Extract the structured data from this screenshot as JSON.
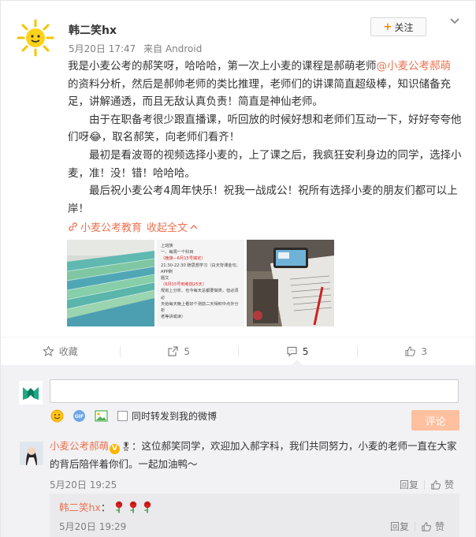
{
  "post": {
    "username": "韩二笑hx",
    "date": "5月20日 17:47",
    "source": "来自 Android",
    "follow_label": "关注",
    "paragraphs": [
      {
        "before": "我是小麦公考的郝笑呀，哈哈哈，第一次上小麦的课程是郝萌老师",
        "mention": "@小麦公考郝萌",
        "after": " 的资料分析，然后是郝帅老师的类比推理，老师们的讲课简直超级棒，知识储备充足，讲解通透，而且无敌认真负责！简直是神仙老师。"
      },
      {
        "text": "由于在职备考很少跟直播课，听回放的时候好想和老师们互动一下，好好夸夸他们呀😂，取名郝笑，向老师们看齐！"
      },
      {
        "text": "最初是看波哥的视频选择小麦的，上了课之后，我疯狂安利身边的同学，选择小麦，准！没！错！哈哈哈。"
      },
      {
        "text": "最后祝小麦公考4周年快乐！祝我一战成公！祝所有选择小麦的朋友们都可以上岸！"
      }
    ],
    "source_link": "小麦公考教育",
    "expand_label": "收起全文"
  },
  "images": [
    {
      "alt": "stack of books"
    },
    {
      "alt": "study schedule note",
      "lines": [
        "上班族",
        "一、每周一个科目",
        "（晚接—6月15号搞定）",
        "21:30-22:30 随思想学习（白天背课金句、APP刷",
        "题文",
        "（6月15号到考前25天）",
        "规划上分析、也今每天总都要做类，但必须必",
        "天给每天晚上看好个测前二天得积中点外分析",
        "老等讲或读）"
      ]
    },
    {
      "alt": "desk with phone and papers"
    }
  ],
  "actions": {
    "favorite": "收藏",
    "repost": "5",
    "comment": "5",
    "like": "3"
  },
  "compose": {
    "placeholder": "",
    "also_repost_label": "同时转发到我的微博",
    "submit_label": "评论"
  },
  "comments": [
    {
      "username": "小麦公考郝萌",
      "text": "：这位郝笑同学，欢迎加入郝字科，我们共同努力，小麦的老师一直在大家的背后陪伴着你们。一起加油鸭～",
      "time": "5月20日 19:25",
      "reply_label": "回复",
      "like_label": "赞",
      "replies": [
        {
          "username": "韩二笑hx",
          "colon": "：",
          "time": "5月20日 19:29",
          "reply_label": "回复",
          "like_label": "赞"
        }
      ]
    }
  ],
  "colors": {
    "link": "#eb7350",
    "accent": "#ff8200",
    "submit_disabled": "#ffc09f"
  }
}
